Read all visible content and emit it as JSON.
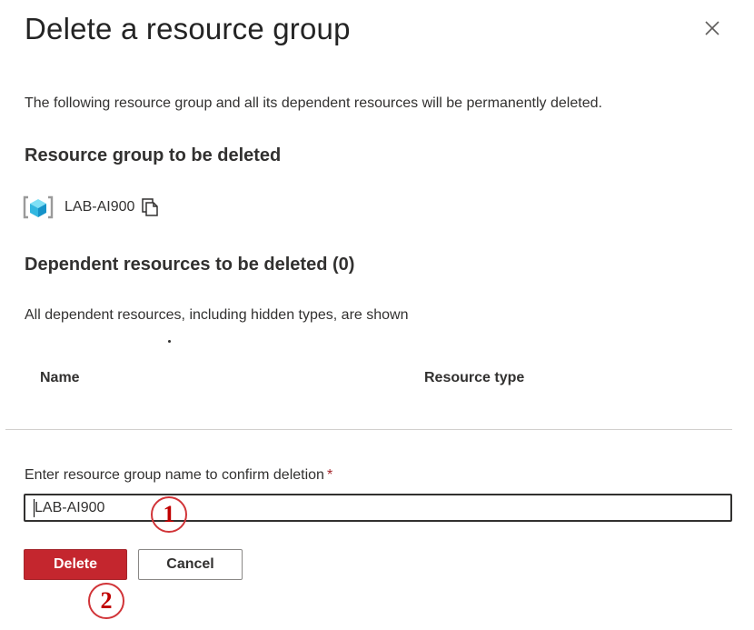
{
  "dialog": {
    "title": "Delete a resource group",
    "description": "The following resource group and all its dependent resources will be permanently deleted.",
    "close_icon": "close-icon"
  },
  "resource_group_section": {
    "heading": "Resource group to be deleted",
    "icon": "resource-group-icon",
    "name": "LAB-AI900",
    "copy_icon": "copy-icon"
  },
  "dependent_section": {
    "heading": "Dependent resources to be deleted (0)",
    "note": "All dependent resources, including hidden types, are shown",
    "columns": [
      "Name",
      "Resource type"
    ]
  },
  "confirm": {
    "label": "Enter resource group name to confirm deletion",
    "required_marker": "*",
    "value": "LAB-AI900"
  },
  "buttons": {
    "delete": "Delete",
    "cancel": "Cancel"
  },
  "annotations": {
    "step1": "1",
    "step2": "2",
    "color": "#c00000"
  },
  "colors": {
    "delete_button": "#c4262e",
    "text": "#323130",
    "required": "#a4262c"
  }
}
